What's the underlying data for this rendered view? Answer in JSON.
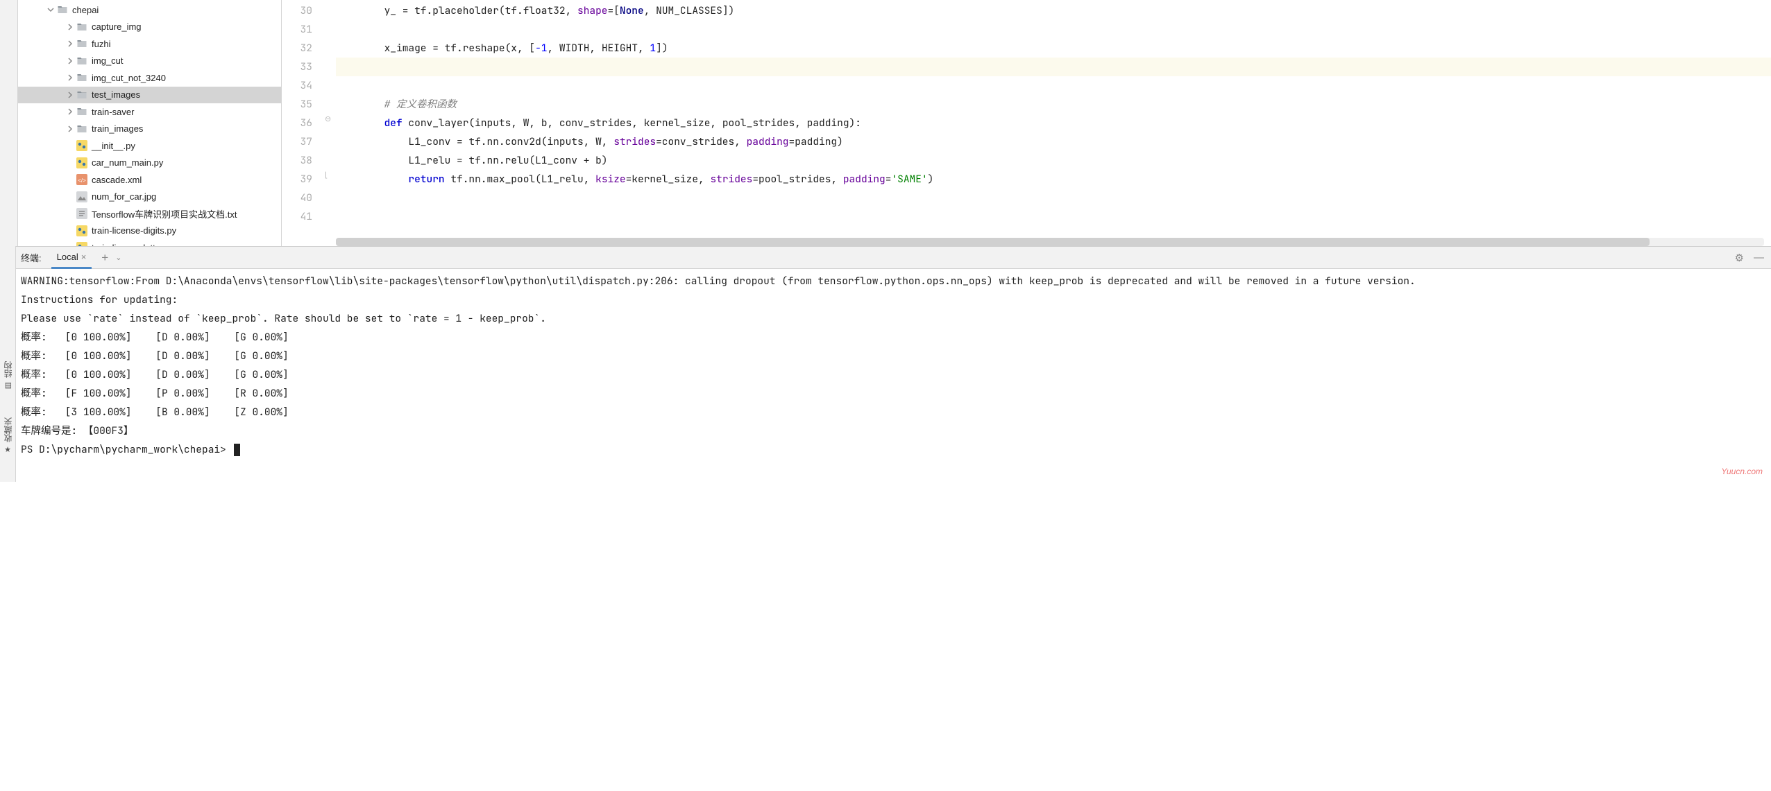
{
  "tree": {
    "root": "chepai",
    "folders": [
      "capture_img",
      "fuzhi",
      "img_cut",
      "img_cut_not_3240",
      "test_images",
      "train-saver",
      "train_images"
    ],
    "selected": "test_images",
    "files": [
      "__init__.py",
      "car_num_main.py",
      "cascade.xml",
      "num_for_car.jpg",
      "Tensorflow车牌识别项目实战文档.txt",
      "train-license-digits.py",
      "train-license-letters.py"
    ]
  },
  "editor": {
    "line_start": 30,
    "lines": [
      {
        "n": 30,
        "seg": [
          {
            "t": "        y_ = tf.placeholder(tf.float32, "
          },
          {
            "t": "shape",
            "c": "kw-purple"
          },
          {
            "t": "=["
          },
          {
            "t": "None",
            "c": "kw-none"
          },
          {
            "t": ", NUM_CLASSES])"
          }
        ]
      },
      {
        "n": 31,
        "seg": [
          {
            "t": ""
          }
        ]
      },
      {
        "n": 32,
        "seg": [
          {
            "t": "        x_image = tf.reshape(x, ["
          },
          {
            "t": "-1",
            "c": "kw-num"
          },
          {
            "t": ", WIDTH, HEIGHT, "
          },
          {
            "t": "1",
            "c": "kw-num"
          },
          {
            "t": "])"
          }
        ]
      },
      {
        "n": 33,
        "seg": [
          {
            "t": ""
          }
        ],
        "hl": true
      },
      {
        "n": 34,
        "seg": [
          {
            "t": ""
          }
        ]
      },
      {
        "n": 35,
        "seg": [
          {
            "t": "        "
          },
          {
            "t": "# 定义卷积函数",
            "c": "kw-comment"
          }
        ]
      },
      {
        "n": 36,
        "seg": [
          {
            "t": "        "
          },
          {
            "t": "def ",
            "c": "kw-blue"
          },
          {
            "t": "conv_layer"
          },
          {
            "t": "(inputs, W, b, conv_strides, kernel_size, pool_strides, padding):"
          }
        ]
      },
      {
        "n": 37,
        "seg": [
          {
            "t": "            L1_conv = tf.nn.conv2d(inputs, W, "
          },
          {
            "t": "strides",
            "c": "kw-purple"
          },
          {
            "t": "=conv_strides, "
          },
          {
            "t": "padding",
            "c": "kw-purple"
          },
          {
            "t": "=padding)"
          }
        ]
      },
      {
        "n": 38,
        "seg": [
          {
            "t": "            L1_relu = tf.nn.relu(L1_conv + b)"
          }
        ]
      },
      {
        "n": 39,
        "seg": [
          {
            "t": "            "
          },
          {
            "t": "return ",
            "c": "kw-blue"
          },
          {
            "t": "tf.nn.max_pool(L1_relu, "
          },
          {
            "t": "ksize",
            "c": "kw-purple"
          },
          {
            "t": "=kernel_size, "
          },
          {
            "t": "strides",
            "c": "kw-purple"
          },
          {
            "t": "=pool_strides, "
          },
          {
            "t": "padding",
            "c": "kw-purple"
          },
          {
            "t": "="
          },
          {
            "t": "'SAME'",
            "c": "kw-str"
          },
          {
            "t": ")"
          }
        ]
      },
      {
        "n": 40,
        "seg": [
          {
            "t": ""
          }
        ]
      },
      {
        "n": 41,
        "seg": [
          {
            "t": ""
          }
        ]
      }
    ]
  },
  "terminal": {
    "label": "终端:",
    "tab": "Local",
    "lines": [
      "WARNING:tensorflow:From D:\\Anaconda\\envs\\tensorflow\\lib\\site-packages\\tensorflow\\python\\util\\dispatch.py:206: calling dropout (from tensorflow.python.ops.nn_ops) with keep_prob is deprecated and will be removed in a future version.",
      "Instructions for updating:",
      "Please use `rate` instead of `keep_prob`. Rate should be set to `rate = 1 - keep_prob`.",
      "概率:   [0 100.00%]    [D 0.00%]    [G 0.00%]",
      "概率:   [0 100.00%]    [D 0.00%]    [G 0.00%]",
      "概率:   [0 100.00%]    [D 0.00%]    [G 0.00%]",
      "概率:   [F 100.00%]    [P 0.00%]    [R 0.00%]",
      "概率:   [3 100.00%]    [B 0.00%]    [Z 0.00%]",
      "车牌编号是: 【000F3】"
    ],
    "prompt": "PS D:\\pycharm\\pycharm_work\\chepai> "
  },
  "vtabs": {
    "structure": "结构",
    "favorites": "收藏夹"
  },
  "watermark": "Yuucn.com"
}
